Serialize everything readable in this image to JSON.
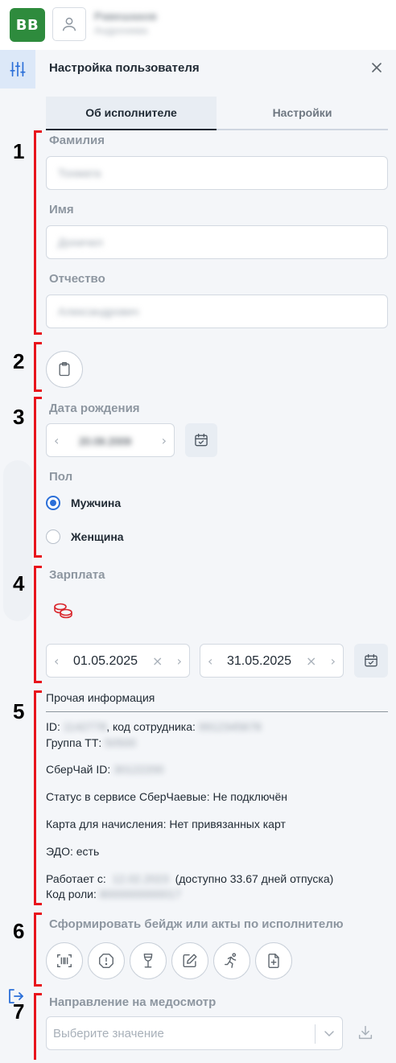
{
  "header": {
    "logo_text": "BB",
    "user_name": "Pавешааов",
    "user_sub": "Андрониква",
    "avatar_icon": "user-icon"
  },
  "rail": {
    "settings_icon": "sliders-icon",
    "logout_icon": "logout-icon"
  },
  "panel": {
    "title": "Настройка пользователя",
    "close_icon": "close-icon"
  },
  "tabs": [
    {
      "label": "Об исполнителе",
      "active": true
    },
    {
      "label": "Настройки",
      "active": false
    }
  ],
  "fields": {
    "surname_label": "Фамилия",
    "surname_value": "Тохмата",
    "name_label": "Имя",
    "name_value": "Доничел",
    "patronymic_label": "Отчество",
    "patronymic_value": "Александрович"
  },
  "clipboard_icon": "clipboard-icon",
  "birth": {
    "label": "Дата рождения",
    "value": "20.09.2009",
    "calendar_icon": "calendar-icon"
  },
  "gender": {
    "label": "Пол",
    "options": [
      {
        "label": "Мужчина",
        "checked": true
      },
      {
        "label": "Женщина",
        "checked": false
      }
    ]
  },
  "salary": {
    "label": "Зарплата",
    "coins_icon": "coins-icon",
    "date_from": "01.05.2025",
    "date_to": "31.05.2025",
    "calendar_icon": "calendar-icon",
    "coins_color": "#d9262c"
  },
  "other": {
    "title": "Прочая информация",
    "id_prefix": "ID:",
    "id_value": "1142778",
    "employee_code_label": ", код сотрудника:",
    "employee_code_value": "9912345678",
    "group_label": "Группа ТТ:",
    "group_value": "50500",
    "sber_id_label": "СберЧай ID:",
    "sber_id_value": "30122200",
    "status_line": "Статус в сервисе СберЧаевые: Не подключён",
    "card_line": "Карта для начисления: Нет привязанных карт",
    "edo_line": "ЭДО: есть",
    "works_since_label": "Работает с:",
    "works_since_value": "12.02.2023",
    "vacation_text": "(доступно 33.67 дней отпуска)",
    "role_label": "Код роли:",
    "role_value": "8000000000017"
  },
  "badge": {
    "label": "Сформировать бейдж или акты по исполнителю",
    "buttons": [
      {
        "name": "barcode-scan-icon"
      },
      {
        "name": "alert-octagon-icon"
      },
      {
        "name": "wine-glass-icon"
      },
      {
        "name": "edit-icon"
      },
      {
        "name": "running-person-icon"
      },
      {
        "name": "add-document-icon"
      }
    ]
  },
  "medical": {
    "label": "Направление на медосмотр",
    "placeholder": "Выберите значение",
    "download_icon": "download-icon"
  },
  "annotations": [
    "1",
    "2",
    "3",
    "4",
    "5",
    "6",
    "7"
  ],
  "colors": {
    "accent": "#2b6fd8",
    "logo": "#2e8b3d",
    "annotation": "#e8141c"
  }
}
